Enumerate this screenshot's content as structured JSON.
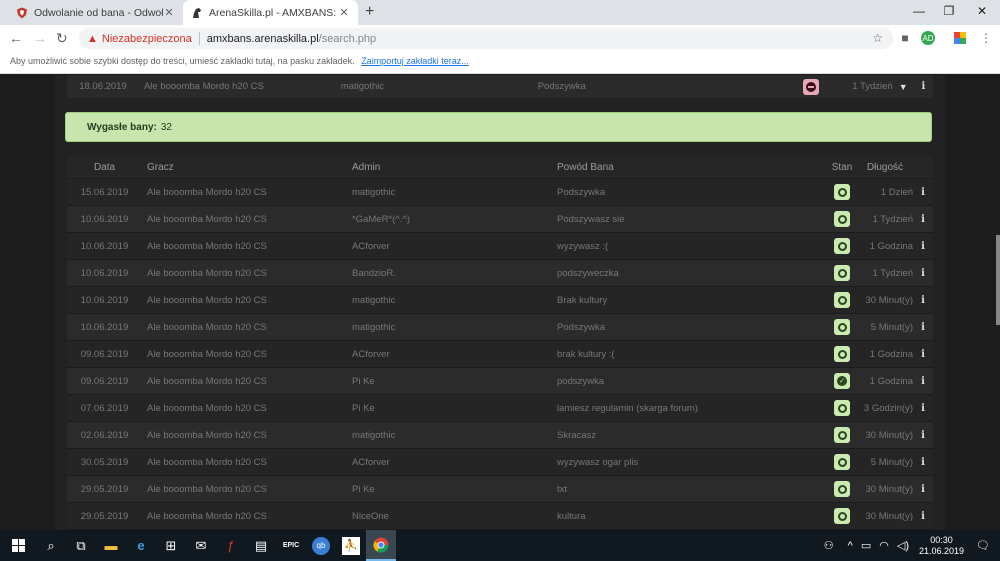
{
  "browser": {
    "tabs": [
      {
        "title": "Odwolanie od bana - Odwołanie",
        "favicon": "shield-icon",
        "color": "#c0392b"
      },
      {
        "title": "ArenaSkilla.pl - AMXBANS: Szukaj",
        "favicon": "horse-icon",
        "active": true
      }
    ],
    "new_tab": "+",
    "security_label": "Niezabezpieczona",
    "url_host": "amxbans.arenaskilla.pl",
    "url_path": "/search.php",
    "profile_badge": "AD",
    "bookmark_hint": "Aby umożliwić sobie szybki dostęp do treści, umieść zakładki tutaj, na pasku zakładek.",
    "bookmark_import": "Zaimportuj zakładki teraz..."
  },
  "active_row": {
    "date": "18.06.2019",
    "player": "Ale booomba Mordo h20 CS",
    "admin": "matigothic",
    "reason": "Podszywka",
    "length": "1 Tydzień"
  },
  "expired": {
    "label": "Wygasłe bany:",
    "count": "32"
  },
  "table": {
    "headers": {
      "date": "Data",
      "player": "Gracz",
      "admin": "Admin",
      "reason": "Powód Bana",
      "status": "Stan",
      "length": "Długość"
    },
    "rows": [
      {
        "date": "15.06.2019",
        "player": "Ale booomba Mordo h20 CS",
        "admin": "matigothic",
        "reason": "Podszywka",
        "length": "1 Dzień"
      },
      {
        "date": "10.06.2019",
        "player": "Ale booomba Mordo h20 CS",
        "admin": "*GaMeR*(^.^)",
        "reason": "Podszywasz sie",
        "length": "1 Tydzień"
      },
      {
        "date": "10.06.2019",
        "player": "Ale booomba Mordo h20 CS",
        "admin": "ACforver",
        "reason": "wyzywasz :(",
        "length": "1 Godzina"
      },
      {
        "date": "10.06.2019",
        "player": "Ale booomba Mordo h20 CS",
        "admin": "BandzioR.",
        "reason": "podszyweczka",
        "length": "1 Tydzień"
      },
      {
        "date": "10.06.2019",
        "player": "Ale booomba Mordo h20 CS",
        "admin": "matigothic",
        "reason": "Brak kultury",
        "length": "30 Minut(y)"
      },
      {
        "date": "10.06.2019",
        "player": "Ale booomba Mordo h20 CS",
        "admin": "matigothic",
        "reason": "Podszywka",
        "length": "5 Minut(y)"
      },
      {
        "date": "09.06.2019",
        "player": "Ale booomba Mordo h20 CS",
        "admin": "ACforver",
        "reason": "brak kultury :(",
        "length": "1 Godzina"
      },
      {
        "date": "09.06.2019",
        "player": "Ale booomba Mordo h20 CS",
        "admin": "Pi Ke",
        "reason": "podszywka",
        "length": "1 Godzina",
        "checked": true
      },
      {
        "date": "07.06.2019",
        "player": "Ale booomba Mordo h20 CS",
        "admin": "Pi Ke",
        "reason": "lamiesz regulamin (skarga forum)",
        "length": "3 Godzin(y)"
      },
      {
        "date": "02.06.2019",
        "player": "Ale booomba Mordo h20 CS",
        "admin": "matigothic",
        "reason": "Skracasz",
        "length": "30 Minut(y)"
      },
      {
        "date": "30.05.2019",
        "player": "Ale booomba Mordo h20 CS",
        "admin": "ACforver",
        "reason": "wyzywasz ogar plis",
        "length": "5 Minut(y)"
      },
      {
        "date": "29.05.2019",
        "player": "Ale booomba Mordo h20 CS",
        "admin": "Pi Ke",
        "reason": "txt",
        "length": "30 Minut(y)"
      },
      {
        "date": "29.05.2019",
        "player": "Ale booomba Mordo h20 CS",
        "admin": "NiceOne",
        "reason": "kultura",
        "length": "30 Minut(y)"
      }
    ]
  },
  "taskbar": {
    "time": "00:30",
    "date": "21.06.2019",
    "epic_label": "EPIC",
    "qb_label": "qb"
  }
}
